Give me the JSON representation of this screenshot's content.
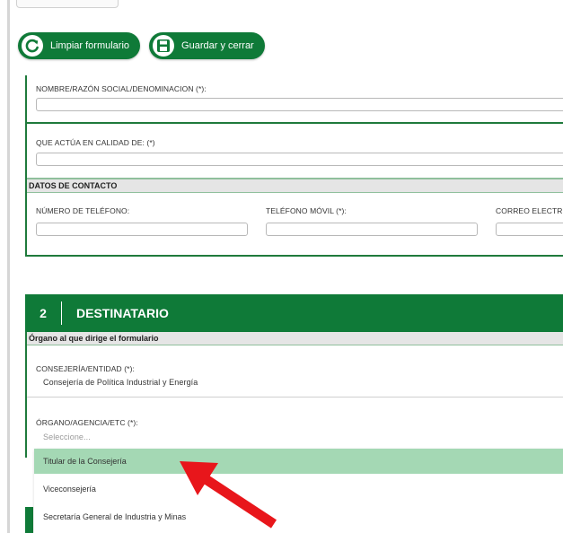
{
  "toolbar": {
    "clear_label": "Limpiar formulario",
    "save_close_label": "Guardar y cerrar",
    "clear_icon": "refresh-icon",
    "save_icon": "save-icon"
  },
  "section1": {
    "name_label": "NOMBRE/RAZÓN SOCIAL/DENOMINACION (*):",
    "quality_label": "QUE ACTÚA EN CALIDAD DE: (*)",
    "contact_header": "DATOS DE CONTACTO",
    "phone_label": "NÚMERO DE TELÉFONO:",
    "mobile_label": "TELÉFONO MÓVIL (*):",
    "email_label": "CORREO ELECTR"
  },
  "section2": {
    "number": "2",
    "title": "DESTINATARIO",
    "organ_subhead": "Órgano al que dirige el formulario",
    "consejeria_label": "CONSEJERÍA/ENTIDAD (*):",
    "consejeria_value": "Consejería de Política Industrial y Energía",
    "organo_label": "ÓRGANO/AGENCIA/ETC (*):",
    "organo_placeholder": "Seleccione..."
  },
  "dropdown": {
    "options": [
      "Titular de la Consejería",
      "Viceconsejería",
      "Secretaría General de Industria y Minas"
    ],
    "highlighted_index": 0
  },
  "colors": {
    "primary_green": "#0f7a38",
    "highlight_green": "#a4d8b4",
    "annotation_red": "#e8161b"
  }
}
